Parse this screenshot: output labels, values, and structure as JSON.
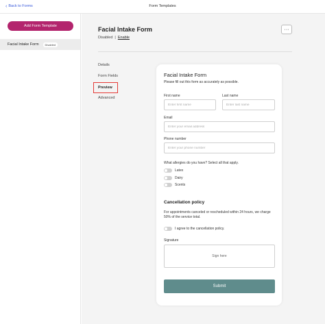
{
  "topbar": {
    "back_label": "Back to Forms",
    "title": "Form Templates"
  },
  "sidebar": {
    "add_button": "Add Form Template",
    "items": [
      {
        "label": "Facial Intake Form",
        "badge": "Disabled"
      }
    ]
  },
  "header": {
    "title": "Facial Intake Form",
    "status": "Disabled",
    "separator": "|",
    "enable_link": "Enable",
    "more_label": "···"
  },
  "nav": {
    "items": [
      {
        "label": "Details"
      },
      {
        "label": "Form Fields"
      },
      {
        "label": "Preview"
      },
      {
        "label": "Advanced"
      }
    ],
    "active": "Preview"
  },
  "preview": {
    "title": "Facial Intake Form",
    "subtitle": "Please fill out this form as accurately as possible.",
    "first_name": {
      "label": "First name",
      "placeholder": "Enter first name"
    },
    "last_name": {
      "label": "Last name",
      "placeholder": "Enter last name"
    },
    "email": {
      "label": "Email",
      "placeholder": "Enter your email address"
    },
    "phone": {
      "label": "Phone number",
      "placeholder": "Enter your phone number"
    },
    "allergies": {
      "question": "What allergies do you have? Select all that apply.",
      "options": [
        "Latex",
        "Dairy",
        "Scents"
      ]
    },
    "cancellation": {
      "title": "Cancellation policy",
      "text": "For appointments canceled or rescheduled within 24 hours, we charge 50% of the service total.",
      "agree_label": "I agree to the cancellation policy."
    },
    "signature": {
      "label": "Signature",
      "placeholder": "Sign here"
    },
    "submit_label": "Submit"
  },
  "colors": {
    "brand": "#b3246d",
    "submit": "#5f8c8c",
    "link": "#3b5bdb",
    "highlight": "#e53935"
  }
}
